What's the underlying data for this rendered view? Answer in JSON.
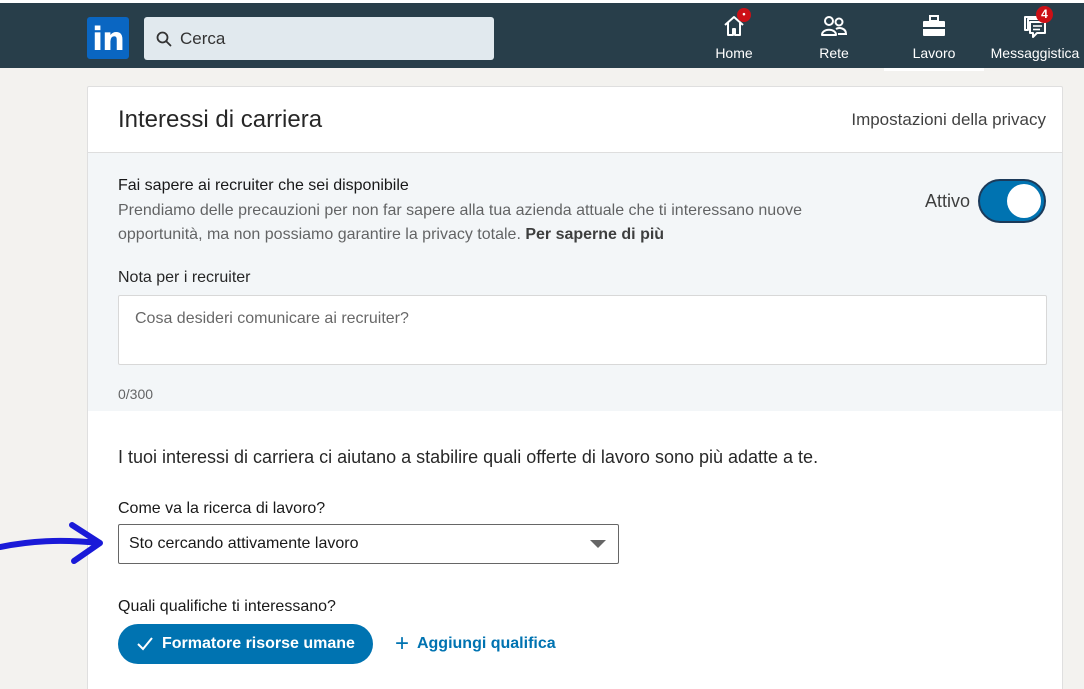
{
  "nav": {
    "search_placeholder": "Cerca",
    "items": [
      {
        "label": "Home",
        "badge": "•"
      },
      {
        "label": "Rete"
      },
      {
        "label": "Lavoro"
      },
      {
        "label": "Messaggistica",
        "badge": "4"
      }
    ]
  },
  "card": {
    "title": "Interessi di carriera",
    "privacy_link": "Impostazioni della privacy",
    "open_to_recruiters": {
      "title": "Fai sapere ai recruiter che sei disponibile",
      "description": "Prendiamo delle precauzioni per non far sapere alla tua azienda attuale che ti interessano nuove opportunità, ma non possiamo garantire la privacy totale.",
      "learn_more": "Per saperne di più",
      "toggle_label": "Attivo"
    },
    "note": {
      "label": "Nota per i recruiter",
      "placeholder": "Cosa desideri comunicare ai recruiter?",
      "counter": "0/300"
    },
    "intro": "I tuoi interessi di carriera ci aiutano a stabilire quali offerte di lavoro sono più adatte a te.",
    "job_search": {
      "label": "Come va la ricerca di lavoro?",
      "selected": "Sto cercando attivamente lavoro"
    },
    "titles": {
      "label": "Quali qualifiche ti interessano?",
      "chip": "Formatore risorse umane",
      "add_link": "Aggiungi qualifica"
    }
  },
  "colors": {
    "nav_bg": "#283e4a",
    "accent": "#0073b1",
    "badge": "#cc1016",
    "annotation_arrow": "#1a1ad8"
  }
}
